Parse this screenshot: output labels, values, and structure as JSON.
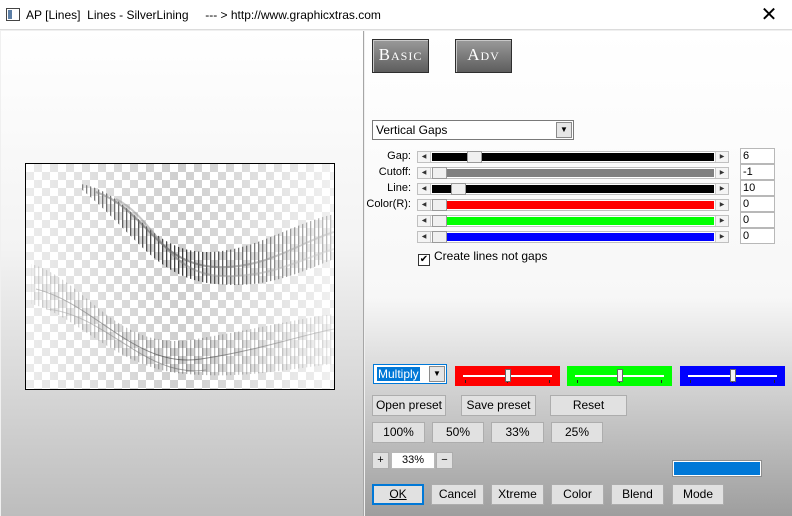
{
  "window": {
    "title": "AP [Lines]  Lines - SilverLining     --- > http://www.graphicxtras.com",
    "close_glyph": "✕"
  },
  "tabs": {
    "basic": "Basic",
    "adv": "Adv"
  },
  "mode_select": {
    "value": "Vertical Gaps"
  },
  "sliders": [
    {
      "label": "Gap:",
      "value": "6",
      "color": "#000000",
      "level": 0.13
    },
    {
      "label": "Cutoff:",
      "value": "-1",
      "color": "#808080",
      "level": 0.0
    },
    {
      "label": "Line:",
      "value": "10",
      "color": "#000000",
      "level": 0.07
    },
    {
      "label": "Color(R):",
      "value": "0",
      "color": "#ff0000",
      "level": 0.0
    },
    {
      "label": "",
      "value": "0",
      "color": "#00ff00",
      "level": 0.0
    },
    {
      "label": "",
      "value": "0",
      "color": "#0000ff",
      "level": 0.0
    }
  ],
  "checkbox": {
    "label": "Create lines not gaps",
    "checked_glyph": "✔"
  },
  "blend_select": {
    "value": "Multiply"
  },
  "color_panels": [
    {
      "color": "#ff0000",
      "level": 0.5
    },
    {
      "color": "#00ff00",
      "level": 0.5
    },
    {
      "color": "#0000ff",
      "level": 0.5
    }
  ],
  "preset_buttons": {
    "open": "Open preset",
    "save": "Save preset",
    "reset": "Reset"
  },
  "zoom_buttons": [
    "100%",
    "50%",
    "33%",
    "25%"
  ],
  "zoom": {
    "plus": "+",
    "value": "33%",
    "minus": "−"
  },
  "swatch_color": "#0078d7",
  "bottom_buttons": {
    "ok": "OK",
    "cancel": "Cancel",
    "xtreme": "Xtreme",
    "color": "Color",
    "blend": "Blend",
    "mode": "Mode"
  }
}
